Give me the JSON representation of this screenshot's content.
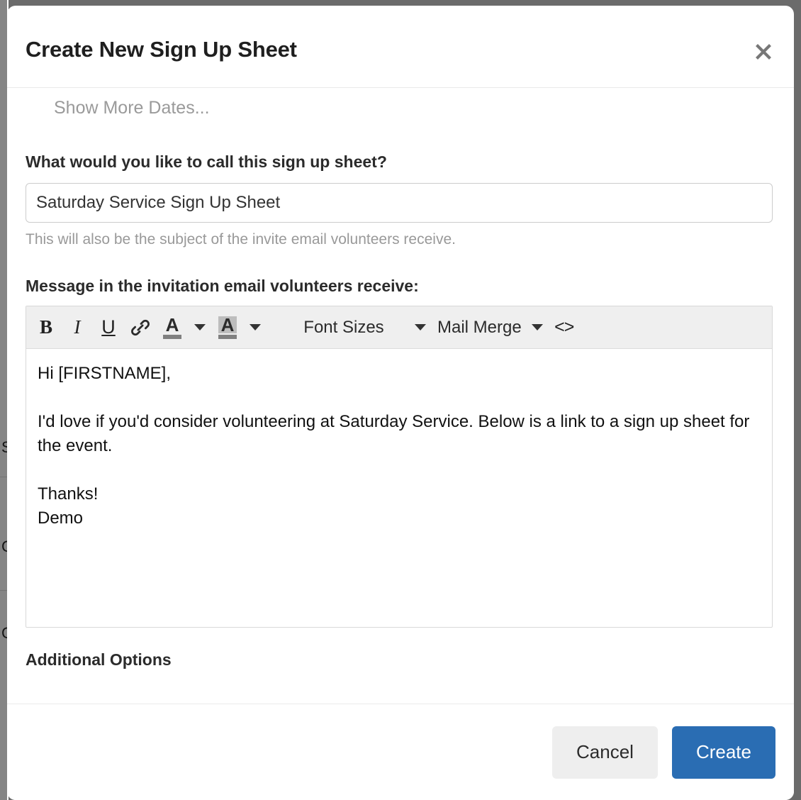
{
  "overlay": {
    "color": "#6b6b6b"
  },
  "background_page": {
    "visible_fragments": [
      "S",
      "C",
      "C"
    ]
  },
  "modal": {
    "title": "Create New Sign Up Sheet",
    "close_icon": "close-icon",
    "body": {
      "show_more_dates_link": "Show More Dates...",
      "name_field": {
        "label": "What would you like to call this sign up sheet?",
        "value": "Saturday Service Sign Up Sheet",
        "placeholder": "",
        "help_text": "This will also be the subject of the invite email volunteers receive."
      },
      "message_field": {
        "label": "Message in the invitation email volunteers receive:",
        "toolbar": {
          "bold": "B",
          "italic": "I",
          "underline": "U",
          "link_icon": "link-icon",
          "text_color": "A",
          "highlight_color": "A",
          "font_sizes": "Font Sizes",
          "mail_merge": "Mail Merge",
          "source_code": "<>"
        },
        "content": "Hi [FIRSTNAME],\n\nI'd love if you'd consider volunteering at Saturday Service. Below is a link to a sign up sheet for the event.\n\nThanks!\nDemo"
      },
      "additional_options_label": "Additional Options"
    },
    "footer": {
      "cancel_label": "Cancel",
      "create_label": "Create",
      "create_color": "#2a6db3"
    }
  }
}
